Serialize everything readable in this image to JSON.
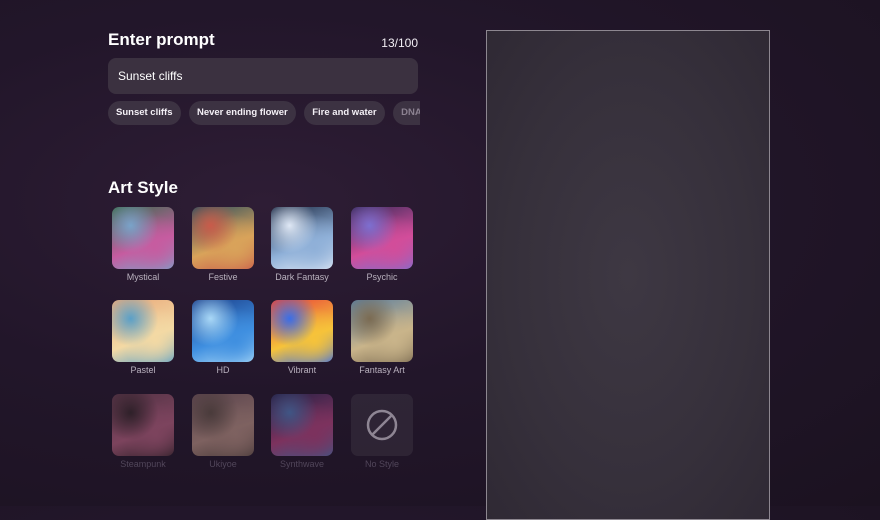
{
  "prompt": {
    "title": "Enter prompt",
    "char_count": "13/100",
    "value": "Sunset cliffs"
  },
  "suggestions": [
    "Sunset cliffs",
    "Never ending flower",
    "Fire and water",
    "DNA tornado"
  ],
  "art_style": {
    "title": "Art Style",
    "styles": [
      {
        "label": "Mystical",
        "icon": "mystical-thumbnail",
        "colors": [
          "#3b6b4e",
          "#c65ca0",
          "#7aa3c9"
        ]
      },
      {
        "label": "Festive",
        "icon": "festive-thumbnail",
        "colors": [
          "#2f4f5e",
          "#d9a35a",
          "#c95b4a"
        ]
      },
      {
        "label": "Dark Fantasy",
        "icon": "dark-fantasy-thumbnail",
        "colors": [
          "#1d2a44",
          "#8fb0d8",
          "#dfe8f5"
        ]
      },
      {
        "label": "Psychic",
        "icon": "psychic-thumbnail",
        "colors": [
          "#3a2a5a",
          "#d24d9a",
          "#7d6fd0"
        ]
      },
      {
        "label": "Pastel",
        "icon": "pastel-thumbnail",
        "colors": [
          "#e9a87a",
          "#f3d9a4",
          "#5aa0c8"
        ]
      },
      {
        "label": "HD",
        "icon": "hd-thumbnail",
        "colors": [
          "#1b3f8a",
          "#3f8fe0",
          "#a9d8f7"
        ]
      },
      {
        "label": "Vibrant",
        "icon": "vibrant-thumbnail",
        "colors": [
          "#e8423a",
          "#f6c33a",
          "#3a6ee8"
        ]
      },
      {
        "label": "Fantasy Art",
        "icon": "fantasy-art-thumbnail",
        "colors": [
          "#5c7fa0",
          "#c9b48a",
          "#7b6b52"
        ]
      },
      {
        "label": "Steampunk",
        "icon": "steampunk-thumbnail",
        "colors": [
          "#7a4a5a",
          "#c86a8a",
          "#3a2a2a"
        ]
      },
      {
        "label": "Ukiyoe",
        "icon": "ukiyoe-thumbnail",
        "colors": [
          "#8a6a6a",
          "#caa08e",
          "#6b5a4a"
        ]
      },
      {
        "label": "Synthwave",
        "icon": "synthwave-thumbnail",
        "colors": [
          "#2a2a5a",
          "#c84a8a",
          "#5a8ad0"
        ]
      },
      {
        "label": "No Style",
        "icon": "no-style-icon",
        "colors": []
      }
    ]
  }
}
